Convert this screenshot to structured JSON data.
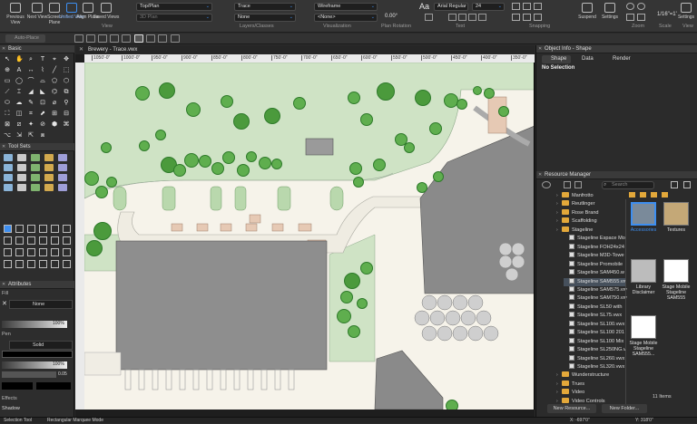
{
  "toolbar": {
    "buttons": [
      {
        "label": "Previous View"
      },
      {
        "label": "Next View"
      },
      {
        "label": "Screen Plane"
      },
      {
        "label": "Unified View"
      },
      {
        "label": "Align Plane"
      },
      {
        "label": "Saved Views"
      }
    ],
    "view_select": "Top/Plan",
    "view_select2": "3D Plan",
    "layer_select": "Trace",
    "class_select": "None",
    "render_select": "Wireframe",
    "none_select": "<None>",
    "rotation_value": "0.00°",
    "font_select": "Arial Regular",
    "font_size": "24",
    "groups": {
      "view": "View",
      "layers": "Layers/Classes",
      "visualization": "Visualization",
      "plan_rotation": "Plan Rotation",
      "text": "Text",
      "snapping": "Snapping",
      "zoom": "Zoom",
      "scale": "Scale",
      "view_label": "View"
    },
    "suspend_label": "Suspend",
    "settings_label": "Settings",
    "scale_value": "1/16\"=1'",
    "settings_label2": "Settings",
    "auto_place": "Auto-Place"
  },
  "basic_panel": {
    "title": "Basic"
  },
  "toolsets_panel": {
    "title": "Tool Sets"
  },
  "attributes": {
    "title": "Attributes",
    "fill_label": "Fill",
    "fill_value": "None",
    "fill_opacity": "100%",
    "pen_label": "Pen",
    "pen_value": "Solid",
    "pen_opacity": "100%",
    "line_weight": "0.05",
    "effects_label": "Effects",
    "shadow_label": "Shadow"
  },
  "document": {
    "tab_title": "Brewery - Trace.vwx",
    "ruler_marks": [
      "1050'-0\"",
      "1000'-0\"",
      "950'-0\"",
      "900'-0\"",
      "850'-0\"",
      "800'-0\"",
      "750'-0\"",
      "700'-0\"",
      "650'-0\"",
      "600'-0\"",
      "550'-0\"",
      "500'-0\"",
      "450'-0\"",
      "400'-0\"",
      "350'-0\""
    ]
  },
  "object_info": {
    "title": "Object Info - Shape",
    "tabs": [
      "Shape",
      "Data",
      "Render"
    ],
    "selection": "No Selection"
  },
  "resource_manager": {
    "title": "Resource Manager",
    "search_placeholder": "Search",
    "tree": [
      {
        "label": "Manfrotto",
        "kind": "folder"
      },
      {
        "label": "Reutlinger",
        "kind": "folder"
      },
      {
        "label": "Rose Brand",
        "kind": "folder"
      },
      {
        "label": "Scaffolding",
        "kind": "folder"
      },
      {
        "label": "Stageline",
        "kind": "folder"
      },
      {
        "label": "Stageline Espace Mo",
        "kind": "symbol"
      },
      {
        "label": "Stageline FOH24x24",
        "kind": "symbol"
      },
      {
        "label": "Stageline M3D-Towe",
        "kind": "symbol"
      },
      {
        "label": "Stageline Promobile",
        "kind": "symbol"
      },
      {
        "label": "Stageline SAM450.w",
        "kind": "symbol"
      },
      {
        "label": "Stageline SAM555.vw",
        "kind": "symbol"
      },
      {
        "label": "Stageline SAM575.vw",
        "kind": "symbol"
      },
      {
        "label": "Stageline SAM750.vw",
        "kind": "symbol"
      },
      {
        "label": "Stageline SL50 with",
        "kind": "symbol"
      },
      {
        "label": "Stageline SL75.vwx",
        "kind": "symbol"
      },
      {
        "label": "Stageline SL100.vwx",
        "kind": "symbol"
      },
      {
        "label": "Stageline SL100 201",
        "kind": "symbol"
      },
      {
        "label": "Stageline SL100 Mix",
        "kind": "symbol"
      },
      {
        "label": "Stageline SL250NG.v",
        "kind": "symbol"
      },
      {
        "label": "Stageline SL260.vwx",
        "kind": "symbol"
      },
      {
        "label": "Stageline SL320.vwx",
        "kind": "symbol"
      },
      {
        "label": "Wunderstructure",
        "kind": "folder"
      },
      {
        "label": "Trues",
        "kind": "folder"
      },
      {
        "label": "Video",
        "kind": "folder"
      },
      {
        "label": "Video Controls",
        "kind": "folder"
      }
    ],
    "tiles": [
      {
        "label": "Accessories"
      },
      {
        "label": "Textures"
      },
      {
        "label": "Library Disclaimer"
      },
      {
        "label": "Stage Mobile Stageline SAM555"
      },
      {
        "label": "Stage Mobile Stageline SAM555..."
      }
    ],
    "count": "11 Items",
    "new_resource": "New Resource...",
    "new_folder": "New Folder..."
  },
  "status": {
    "left": "Selection Tool",
    "mode": "Rectangular Marquee Mode",
    "x": "X: -697'0\"",
    "y": "Y: 318'0\""
  },
  "colors": {
    "accent": "#3d8ef0",
    "folder": "#e3a83a",
    "grass": "#c9dfc0",
    "building": "#8c8c8c"
  }
}
